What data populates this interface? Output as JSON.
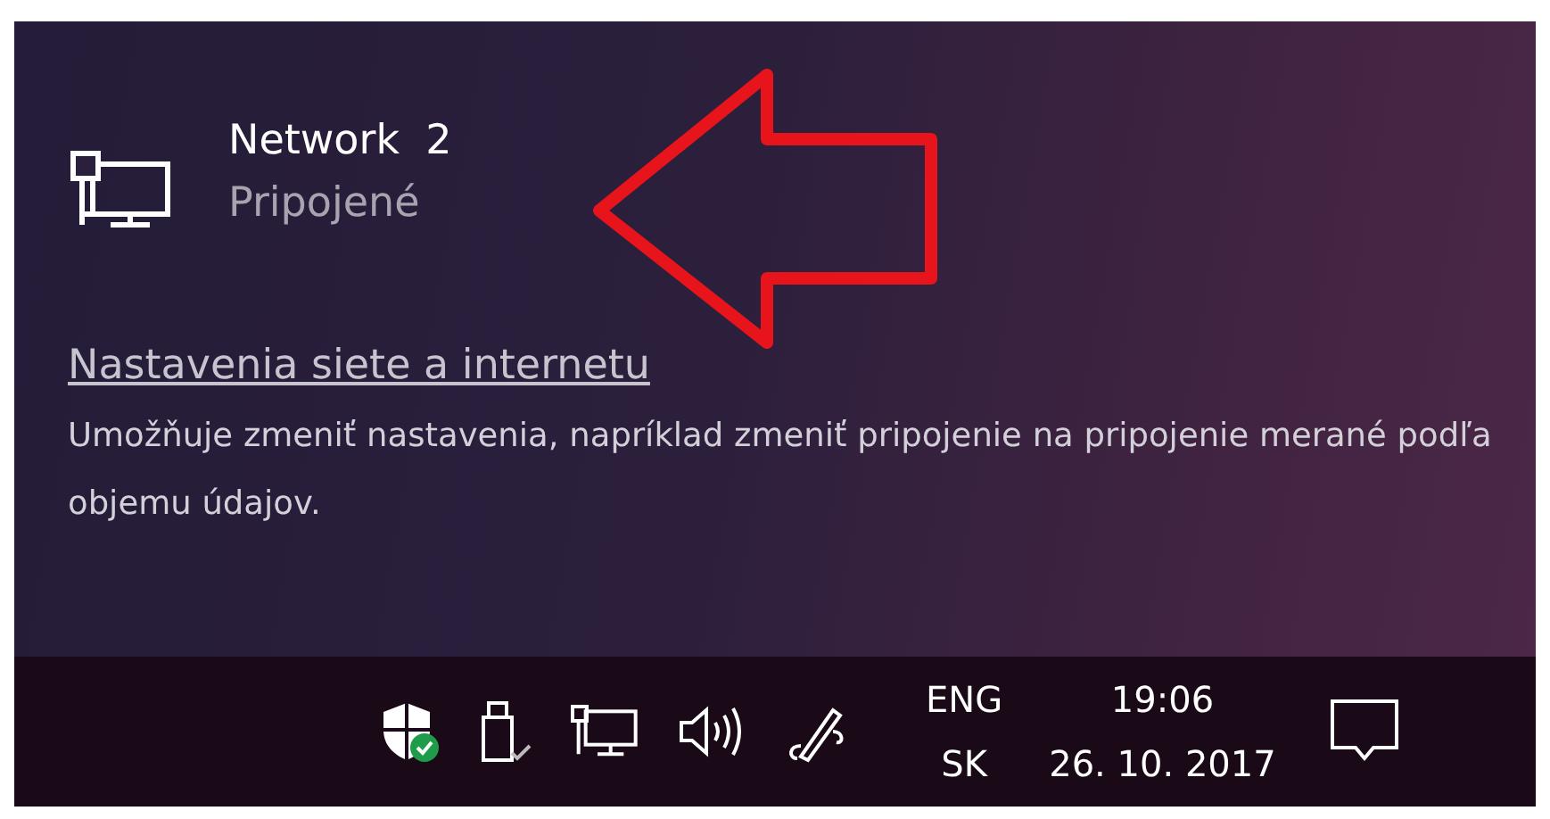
{
  "network": {
    "name": "Network  2",
    "status": "Pripojené"
  },
  "settings_link": {
    "label": "Nastavenia siete a internetu",
    "description": "Umožňuje zmeniť nastavenia, napríklad zmeniť pripojenie na pripojenie merané podľa objemu údajov."
  },
  "taskbar": {
    "language": {
      "input": "ENG",
      "layout": "SK"
    },
    "clock": {
      "time": "19:06",
      "date": "26. 10. 2017"
    }
  }
}
